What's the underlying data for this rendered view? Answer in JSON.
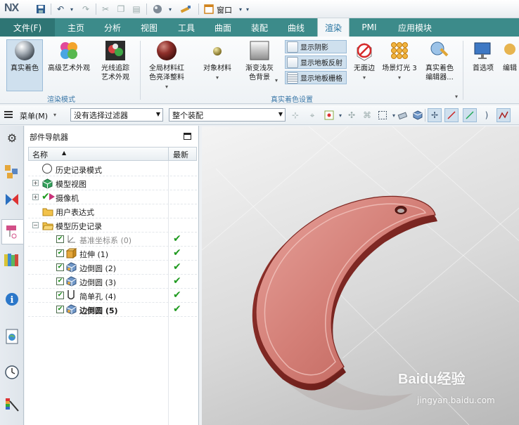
{
  "app": {
    "logo": "NX",
    "window_menu": "窗口"
  },
  "menubar": {
    "file": "文件(F)",
    "tabs": [
      "主页",
      "分析",
      "视图",
      "工具",
      "曲面",
      "装配",
      "曲线",
      "渲染",
      "PMI",
      "应用模块"
    ],
    "active_tab": "渲染"
  },
  "ribbon": {
    "group_render_mode": "渲染模式",
    "group_true_shading": "真实着色设置",
    "true_shading": "真实着色",
    "advanced_studio": "高级艺术外观",
    "raytrace_line1": "光线追踪",
    "raytrace_line2": "艺术外观",
    "global_material_line1": "全局材料红",
    "global_material_line2": "色亮泽整料",
    "object_material": "对象材料",
    "gradient_line1": "渐变浅灰",
    "gradient_line2": "色背景",
    "show_shadow": "显示阴影",
    "show_floor_reflection": "显示地板反射",
    "show_floor_grid": "显示地板栅格",
    "no_face": "无面边",
    "scene_light": "场景灯光 3",
    "true_shading_editor_line1": "真实着色",
    "true_shading_editor_line2": "编辑器...",
    "preferences": "首选项",
    "edit_cut": "编辑"
  },
  "toolbar2": {
    "menu": "菜单(M)",
    "selection_filter": "没有选择过滤器",
    "scope": "整个装配"
  },
  "navigator": {
    "title": "部件导航器",
    "col_name": "名称",
    "col_latest": "最新",
    "rows": [
      {
        "label": "历史记录模式",
        "latest": ""
      },
      {
        "label": "模型视图",
        "latest": ""
      },
      {
        "label": "摄像机",
        "latest": ""
      },
      {
        "label": "用户表达式",
        "latest": ""
      },
      {
        "label": "模型历史记录",
        "latest": ""
      },
      {
        "label": "基准坐标系 (0)",
        "latest": "✔"
      },
      {
        "label": "拉伸 (1)",
        "latest": "✔"
      },
      {
        "label": "边倒圆 (2)",
        "latest": "✔"
      },
      {
        "label": "边倒圆 (3)",
        "latest": "✔"
      },
      {
        "label": "简单孔 (4)",
        "latest": "✔"
      },
      {
        "label": "边倒圆 (5)",
        "latest": "✔"
      }
    ]
  },
  "watermark": {
    "brand": "Baidu经验",
    "url": "jingyan.baidu.com"
  },
  "colors": {
    "accent": "#3c8b8a",
    "part": "#c8706a",
    "check": "#1f9a1f"
  }
}
